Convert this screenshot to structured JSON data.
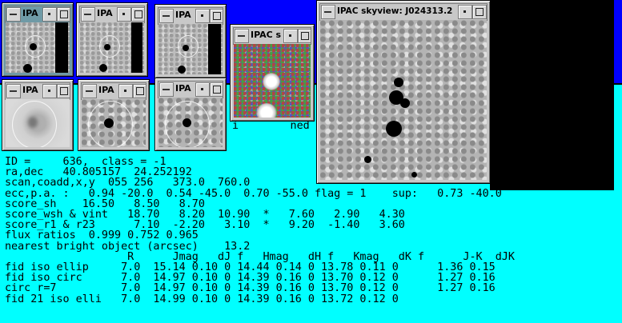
{
  "windows": {
    "w1": {
      "title": "IPA"
    },
    "w2": {
      "title": "IPA"
    },
    "w3": {
      "title": "IPA"
    },
    "w4": {
      "title": "IPAC s"
    },
    "w5": {
      "title": "IPA"
    },
    "w6": {
      "title": "IPA"
    },
    "w7": {
      "title": "IPA"
    },
    "skyview": {
      "title": "IPAC skyview: J024313.2"
    }
  },
  "terminal": {
    "partial_line": "i        ned search;",
    "lines": [
      "ID =     636,  class = -1",
      "ra,dec   40.805157  24.252192",
      "scan,coadd,x,y  055 256   373.0  760.0",
      "ecc,p.a. :   0.94 -20.0  0.54 -45.0  0.70 -55.0 flag = 1    sup:   0.73 -40.0",
      "score_sh    16.50   8.50   8.70",
      "score_wsh & vint   18.70   8.20  10.90  *   7.60   2.90   4.30",
      "score_r1 & r23      7.10  -2.20   3.10  *   9.20  -1.40   3.60",
      "flux ratios  0.999 0.752 0.965",
      "nearest bright object (arcsec)    13.2",
      "                   R      Jmag   dJ f   Hmag   dH f   Kmag   dK f      J-K  dJK",
      "fid iso ellip     7.0  15.14 0.10 0 14.44 0.14 0 13.78 0.11 0      1.36 0.15",
      "fid iso circ      7.0  14.97 0.10 0 14.39 0.16 0 13.70 0.12 0      1.27 0.16",
      "circ r=7          7.0  14.97 0.10 0 14.39 0.16 0 13.70 0.12 0      1.27 0.16",
      "fid 21 iso elli   7.0  14.99 0.10 0 14.39 0.16 0 13.72 0.12 0"
    ]
  }
}
